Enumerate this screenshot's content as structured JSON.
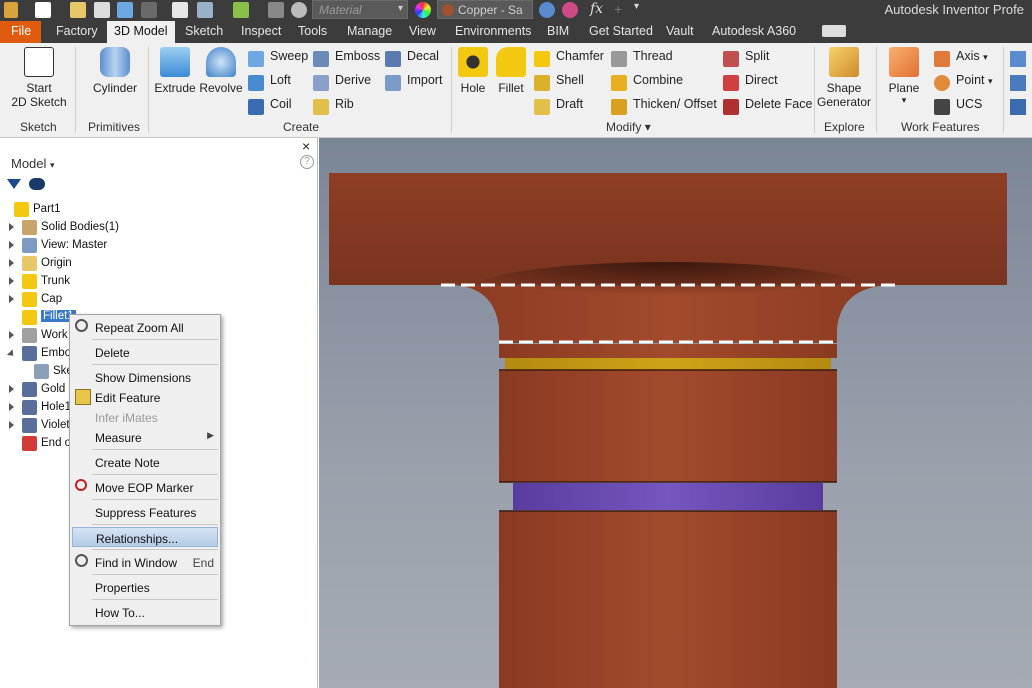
{
  "quick_access": {
    "material_placeholder": "Material",
    "appearance_value": "Copper - Sa",
    "fx_symbol": "fx"
  },
  "app_title": "Autodesk Inventor Profe",
  "tabs": [
    "File",
    "Factory",
    "3D Model",
    "Sketch",
    "Inspect",
    "Tools",
    "Manage",
    "View",
    "Environments",
    "BIM",
    "Get Started",
    "Vault",
    "Autodesk A360"
  ],
  "ribbon": {
    "groups": {
      "sketch": "Sketch",
      "primitives": "Primitives",
      "create": "Create",
      "modify": "Modify",
      "explore": "Explore",
      "work_features": "Work Features"
    },
    "start_sketch": [
      "Start",
      "2D Sketch"
    ],
    "cylinder": "Cylinder",
    "extrude": "Extrude",
    "revolve": "Revolve",
    "create_small": [
      "Sweep",
      "Loft",
      "Coil",
      "Emboss",
      "Derive",
      "Rib",
      "Decal",
      "Import"
    ],
    "hole": "Hole",
    "fillet": "Fillet",
    "modify_small": [
      "Chamfer",
      "Shell",
      "Draft",
      "Thread",
      "Combine",
      "Thicken/ Offset",
      "Split",
      "Direct",
      "Delete Face"
    ],
    "shape_generator": [
      "Shape",
      "Generator"
    ],
    "plane": "Plane",
    "work_small": [
      "Axis",
      "Point",
      "UCS"
    ]
  },
  "browser": {
    "title": "Model",
    "help": "?",
    "close": "×",
    "tree": [
      {
        "label": "Part1",
        "color": "#f2c811"
      },
      {
        "label": "Solid Bodies(1)",
        "color": "#c8a46a"
      },
      {
        "label": "View: Master",
        "color": "#7d9bc1"
      },
      {
        "label": "Origin",
        "color": "#e8c76a"
      },
      {
        "label": "Trunk",
        "color": "#f2c811"
      },
      {
        "label": "Cap",
        "color": "#f2c811"
      },
      {
        "label": "Fillet1",
        "color": "#f2c811"
      },
      {
        "label": "Work",
        "color": "#a0a0a0"
      },
      {
        "label": "Embos",
        "color": "#5a6e9a"
      },
      {
        "label": "Sket",
        "color": "#8aa0b8"
      },
      {
        "label": "Gold F",
        "color": "#5a6e9a"
      },
      {
        "label": "Hole1",
        "color": "#5a6e9a"
      },
      {
        "label": "Violet",
        "color": "#5a6e9a"
      },
      {
        "label": "End o",
        "color": "#d43a3a"
      }
    ]
  },
  "context_menu": {
    "items": [
      {
        "label": "Repeat Zoom All",
        "shortcut": "",
        "disabled": false,
        "highlighted": false
      },
      {
        "label": "Delete",
        "shortcut": "",
        "disabled": false,
        "highlighted": false
      },
      {
        "label": "Show Dimensions",
        "shortcut": "",
        "disabled": false,
        "highlighted": false
      },
      {
        "label": "Edit Feature",
        "shortcut": "",
        "disabled": false,
        "highlighted": false
      },
      {
        "label": "Infer iMates",
        "shortcut": "",
        "disabled": true,
        "highlighted": false
      },
      {
        "label": "Measure",
        "shortcut": "",
        "disabled": false,
        "highlighted": false
      },
      {
        "label": "Create Note",
        "shortcut": "",
        "disabled": false,
        "highlighted": false
      },
      {
        "label": "Move EOP Marker",
        "shortcut": "",
        "disabled": false,
        "highlighted": false
      },
      {
        "label": "Suppress Features",
        "shortcut": "",
        "disabled": false,
        "highlighted": false
      },
      {
        "label": "Relationships...",
        "shortcut": "",
        "disabled": false,
        "highlighted": true
      },
      {
        "label": "Find in Window",
        "shortcut": "End",
        "disabled": false,
        "highlighted": false
      },
      {
        "label": "Properties",
        "shortcut": "",
        "disabled": false,
        "highlighted": false
      },
      {
        "label": "How To...",
        "shortcut": "",
        "disabled": false,
        "highlighted": false
      }
    ]
  },
  "colors": {
    "copper": "#9a4a2e",
    "gold": "#c9a11a",
    "violet": "#6a4ab0",
    "accent_file": "#e05a10"
  }
}
